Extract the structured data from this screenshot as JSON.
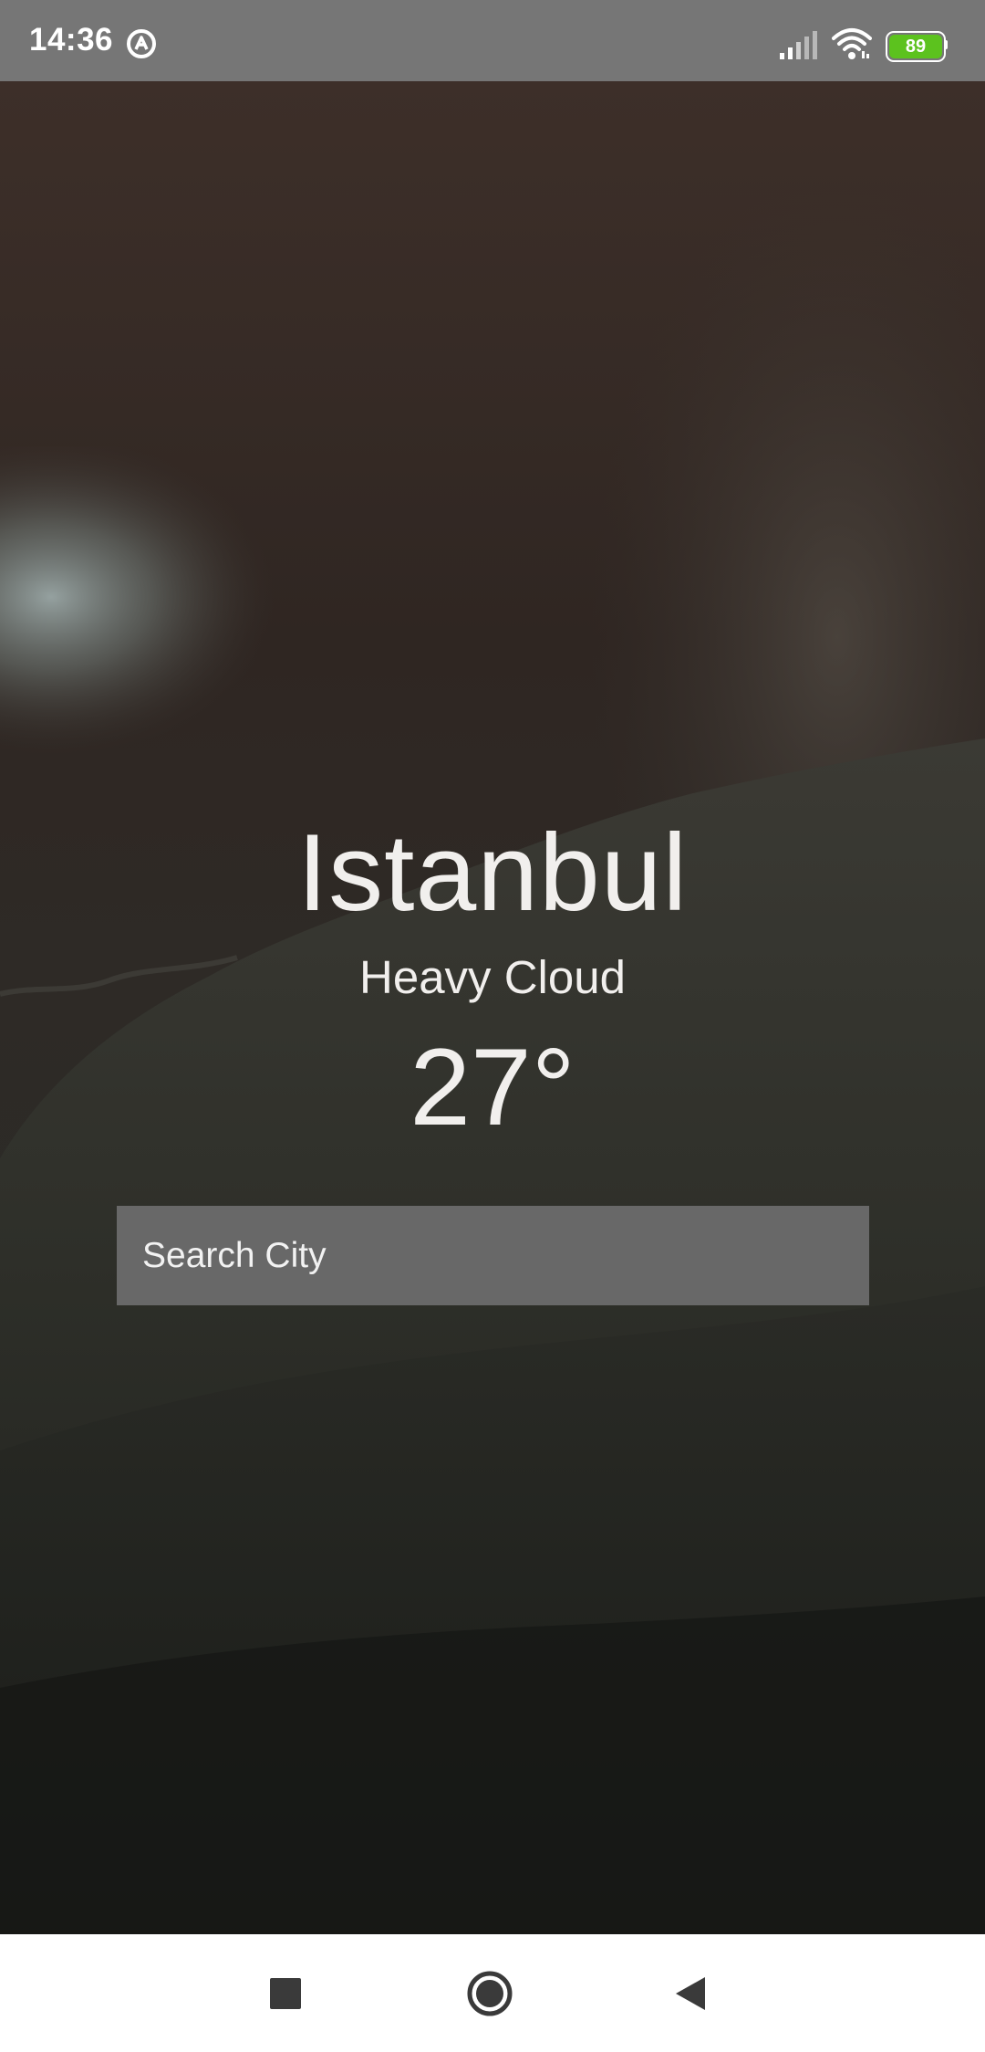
{
  "status_bar": {
    "time": "14:36",
    "battery_level": "89",
    "icons": [
      "app-notification-icon",
      "signal-icon",
      "wifi-icon",
      "battery-icon"
    ],
    "background_color": "#767676",
    "battery_color": "#5cc21e"
  },
  "weather": {
    "city": "Istanbul",
    "condition": "Heavy Cloud",
    "temperature": "27°"
  },
  "search": {
    "placeholder": "Search City",
    "value": ""
  },
  "nav_bar": {
    "icons": [
      "recents-square-icon",
      "home-circle-icon",
      "back-triangle-icon"
    ]
  },
  "colors": {
    "text": "#f1efed",
    "search_background": "#6e6e6e"
  }
}
